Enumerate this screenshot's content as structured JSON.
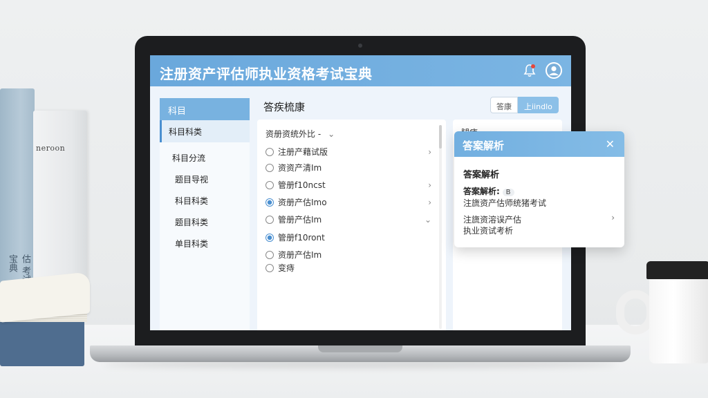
{
  "app": {
    "title": "注册资产评估师执业资格考试宝典"
  },
  "sidebar": {
    "header": "科目",
    "items": [
      {
        "label": "科目科类"
      },
      {
        "label": "科目分流"
      },
      {
        "label": "题目导视"
      },
      {
        "label": "科目科类"
      },
      {
        "label": "题目科类"
      },
      {
        "label": "单目科类"
      }
    ]
  },
  "main": {
    "section_title": "答疾梳康",
    "buttons": {
      "secondary": "答康",
      "primary": "上iindlo"
    },
    "list": {
      "header": "资册资统外比 -",
      "options": [
        {
          "label": "注册产藉试版",
          "checked": false,
          "chevron": "›"
        },
        {
          "label": "资资产清Im",
          "checked": false,
          "chevron": ""
        },
        {
          "label": "管册f10ncst",
          "checked": false,
          "chevron": "›"
        },
        {
          "label": "资册产估Imo",
          "checked": true,
          "chevron": "›"
        },
        {
          "label": "管册产估Im",
          "checked": false,
          "chevron": "⌄"
        },
        {
          "label": "管册f10ront",
          "checked": true,
          "chevron": ""
        },
        {
          "label": "资册产估Im",
          "checked": false,
          "chevron": ""
        },
        {
          "label": "变痔",
          "checked": false,
          "chevron": ""
        }
      ]
    },
    "right_panel": {
      "label": "腿痔"
    }
  },
  "popup": {
    "title": "答案解析",
    "heading": "答案解析",
    "line1_label": "答案解析:",
    "line1_badge": "B",
    "line2": "注旒资产估师统猪考试",
    "line3": "注旒资溶误产估",
    "line4": "执业资试考析"
  },
  "book": {
    "spine_text": "neroon",
    "side_text": "资产评估 考试宝典"
  }
}
